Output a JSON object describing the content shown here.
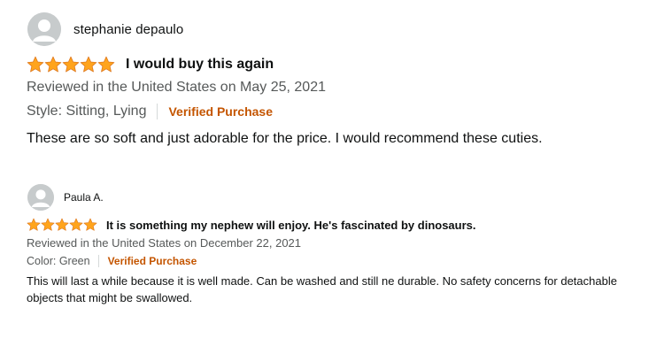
{
  "colors": {
    "star": "#ffa41c",
    "star_outline": "#de7921",
    "verified": "#c45500",
    "meta_text": "#565959",
    "avatar_bg": "#c7cbcc"
  },
  "reviews": [
    {
      "author": "stephanie depaulo",
      "avatar_icon": "default-avatar-icon",
      "rating": 5,
      "rating_max": 5,
      "headline": "I would buy this again",
      "reviewed_line": "Reviewed in the United States on May 25, 2021",
      "variant": "Style: Sitting, Lying",
      "verified_label": "Verified Purchase",
      "body": "These are so soft and just adorable for the price. I would recommend these cuties."
    },
    {
      "author": "Paula A.",
      "avatar_icon": "default-avatar-icon",
      "rating": 5,
      "rating_max": 5,
      "headline": "It is something my nephew will enjoy. He's fascinated by dinosaurs.",
      "reviewed_line": "Reviewed in the United States on December 22, 2021",
      "variant": "Color: Green",
      "verified_label": "Verified Purchase",
      "body": "This will last a while because it is well made. Can be washed and still ne durable. No safety concerns for detachable objects that might be swallowed."
    }
  ]
}
